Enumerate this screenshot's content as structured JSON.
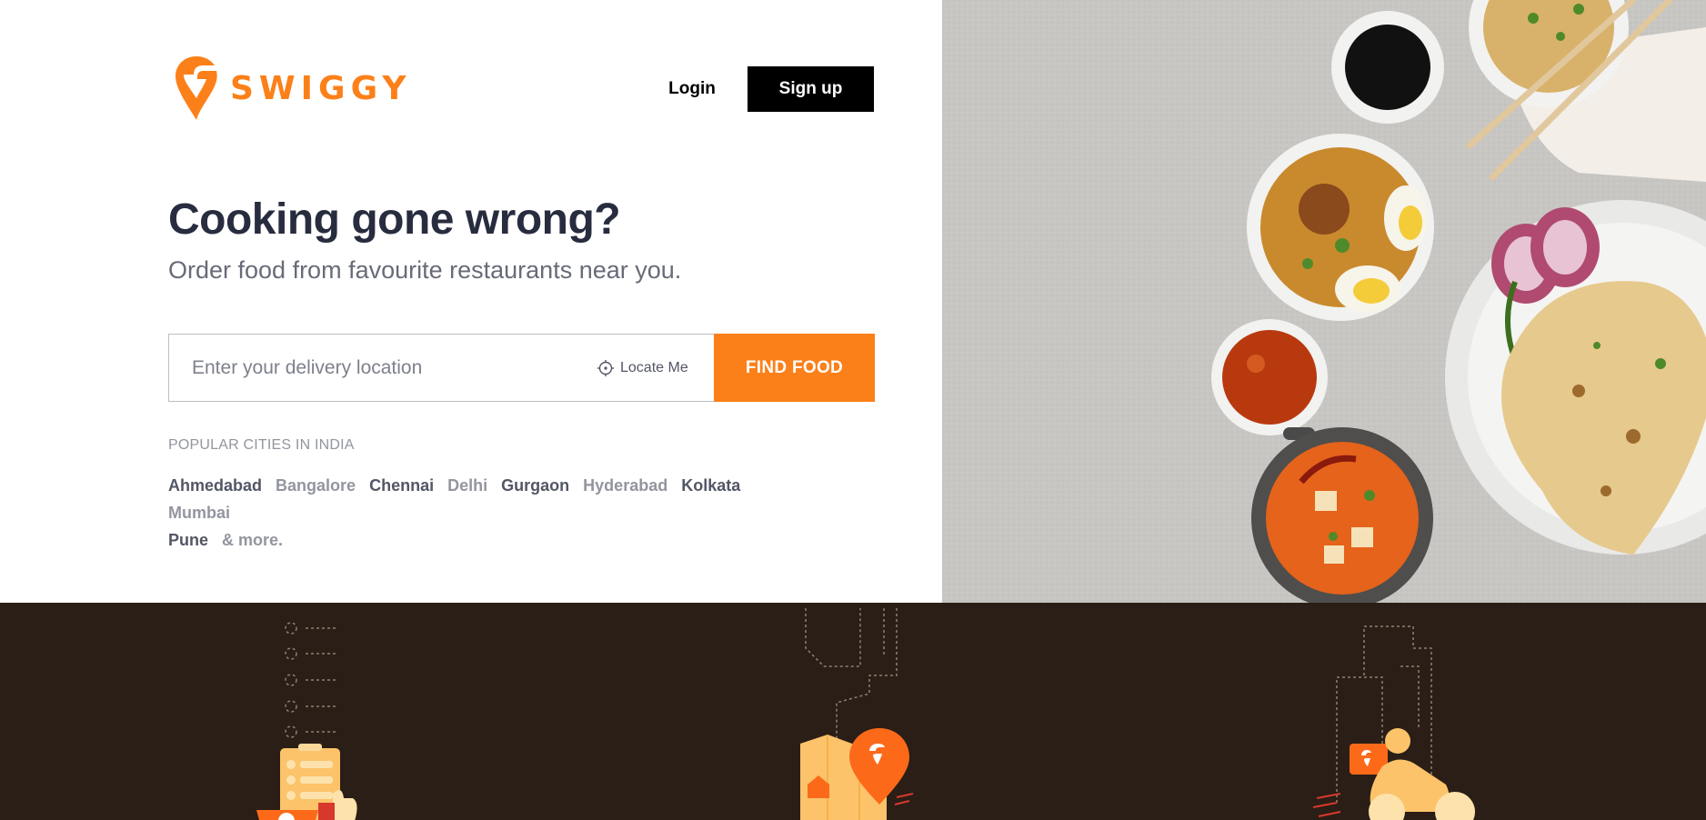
{
  "brand": {
    "name": "SWIGGY",
    "color": "#fc8019"
  },
  "nav": {
    "login_label": "Login",
    "signup_label": "Sign up"
  },
  "hero": {
    "headline": "Cooking gone wrong?",
    "subline": "Order food from favourite restaurants near you."
  },
  "search": {
    "placeholder": "Enter your delivery location",
    "value": "",
    "locate_label": "Locate Me",
    "find_label": "FIND FOOD"
  },
  "popular": {
    "title": "POPULAR CITIES IN INDIA",
    "cities": [
      "Ahmedabad",
      "Bangalore",
      "Chennai",
      "Delhi",
      "Gurgaon",
      "Hyderabad",
      "Kolkata",
      "Mumbai",
      "Pune"
    ],
    "more_label": "& more."
  },
  "colors": {
    "accent": "#fc8019",
    "dark_band": "#2b1e16",
    "text_dark": "#282c3f",
    "text_muted": "#93959f"
  },
  "icons": [
    "swiggy-logo-icon",
    "crosshair-icon",
    "order-list-icon",
    "location-pin-icon",
    "delivery-scooter-icon"
  ]
}
